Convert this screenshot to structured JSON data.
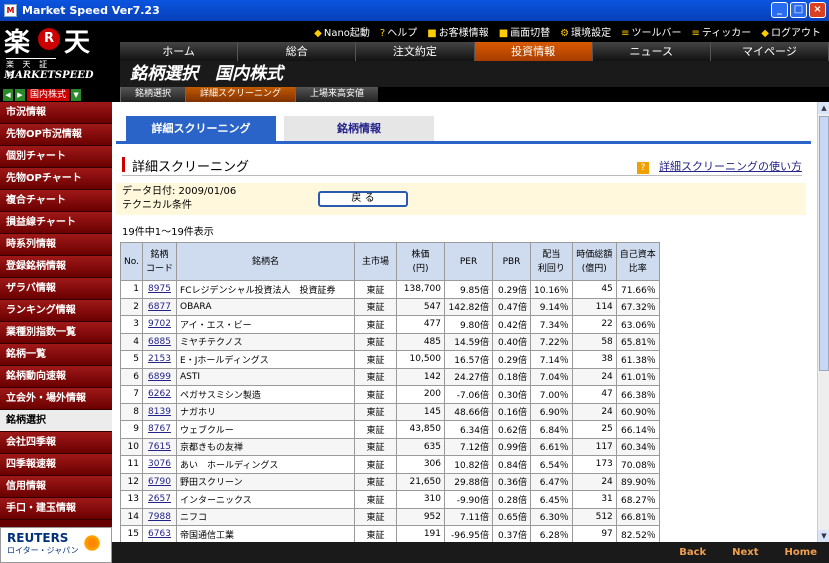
{
  "window": {
    "title": "Market Speed Ver7.23"
  },
  "logo": {
    "big": "楽",
    "r": "R",
    "big2": "天",
    "sub": "楽 天 証 券",
    "ms": "MARKETSPEED"
  },
  "util": [
    "Nano起動",
    "ヘルプ",
    "お客様情報",
    "画面切替",
    "環境設定",
    "ツールバー",
    "ティッカー",
    "ログアウト"
  ],
  "nav": [
    "ホーム",
    "総合",
    "注文約定",
    "投資情報",
    "ニュース",
    "マイページ"
  ],
  "brand": "銘柄選択　国内株式",
  "subnav": {
    "market": "国内株式",
    "tabs": [
      "銘柄選択",
      "詳細スクリーニング",
      "上場来高安値"
    ]
  },
  "sidebar": [
    "市況情報",
    "先物OP市況情報",
    "個別チャート",
    "先物OPチャート",
    "複合チャート",
    "損益線チャート",
    "時系列情報",
    "登録銘柄情報",
    "ザラバ情報",
    "ランキング情報",
    "業種別指数一覧",
    "銘柄一覧",
    "銘柄動向速報",
    "立会外・場外情報",
    "銘柄選択",
    "会社四季報",
    "四季報速報",
    "信用情報",
    "手口・建玉情報"
  ],
  "reuters": {
    "name": "REUTERS",
    "sub": "ロイター・ジャパン"
  },
  "tabs": [
    "詳細スクリーニング",
    "銘柄情報"
  ],
  "section": {
    "title": "詳細スクリーニング",
    "help": "詳細スクリーニングの使い方",
    "help_icon": "?"
  },
  "cond": {
    "date": "データ日付: 2009/01/06",
    "tech": "テクニカル条件",
    "back": "戻 る"
  },
  "count": "19件中1〜19件表示",
  "table": {
    "headers": [
      "No.",
      "銘柄\nコード",
      "銘柄名",
      "主市場",
      "株価\n(円)",
      "PER",
      "PBR",
      "配当\n利回り",
      "時価総額\n(億円)",
      "自己資本\n比率"
    ],
    "rows": [
      [
        "1",
        "8975",
        "FCレジデンシャル投資法人　投資証券",
        "東証",
        "138,700",
        "9.85倍",
        "0.29倍",
        "10.16％",
        "45",
        "71.66％"
      ],
      [
        "2",
        "6877",
        "OBARA",
        "東証",
        "547",
        "142.82倍",
        "0.47倍",
        "9.14％",
        "114",
        "67.32％"
      ],
      [
        "3",
        "9702",
        "アイ・エス・ビー",
        "東証",
        "477",
        "9.80倍",
        "0.42倍",
        "7.34％",
        "22",
        "63.06％"
      ],
      [
        "4",
        "6885",
        "ミヤチテクノス",
        "東証",
        "485",
        "14.59倍",
        "0.40倍",
        "7.22％",
        "58",
        "65.81％"
      ],
      [
        "5",
        "2153",
        "E・Jホールディングス",
        "東証",
        "10,500",
        "16.57倍",
        "0.29倍",
        "7.14％",
        "38",
        "61.38％"
      ],
      [
        "6",
        "6899",
        "ASTI",
        "東証",
        "142",
        "24.27倍",
        "0.18倍",
        "7.04％",
        "24",
        "61.01％"
      ],
      [
        "7",
        "6262",
        "ペガサスミシン製造",
        "東証",
        "200",
        "-7.06倍",
        "0.30倍",
        "7.00％",
        "47",
        "66.38％"
      ],
      [
        "8",
        "8139",
        "ナガホリ",
        "東証",
        "145",
        "48.66倍",
        "0.16倍",
        "6.90％",
        "24",
        "60.90％"
      ],
      [
        "9",
        "8767",
        "ウェブクルー",
        "東証",
        "43,850",
        "6.34倍",
        "0.62倍",
        "6.84％",
        "25",
        "66.14％"
      ],
      [
        "10",
        "7615",
        "京都きもの友禅",
        "東証",
        "635",
        "7.12倍",
        "0.99倍",
        "6.61％",
        "117",
        "60.34％"
      ],
      [
        "11",
        "3076",
        "あい　ホールディングス",
        "東証",
        "306",
        "10.82倍",
        "0.84倍",
        "6.54％",
        "173",
        "70.08％"
      ],
      [
        "12",
        "6790",
        "野田スクリーン",
        "東証",
        "21,650",
        "29.88倍",
        "0.36倍",
        "6.47％",
        "24",
        "89.90％"
      ],
      [
        "13",
        "2657",
        "インターニックス",
        "東証",
        "310",
        "-9.90倍",
        "0.28倍",
        "6.45％",
        "31",
        "68.27％"
      ],
      [
        "14",
        "7988",
        "ニフコ",
        "東証",
        "952",
        "7.11倍",
        "0.65倍",
        "6.30％",
        "512",
        "66.81％"
      ],
      [
        "15",
        "6763",
        "帝国通信工業",
        "東証",
        "191",
        "-96.95倍",
        "0.37倍",
        "6.28％",
        "97",
        "82.52％"
      ]
    ]
  },
  "footer": [
    "Back",
    "Next",
    "Home"
  ]
}
